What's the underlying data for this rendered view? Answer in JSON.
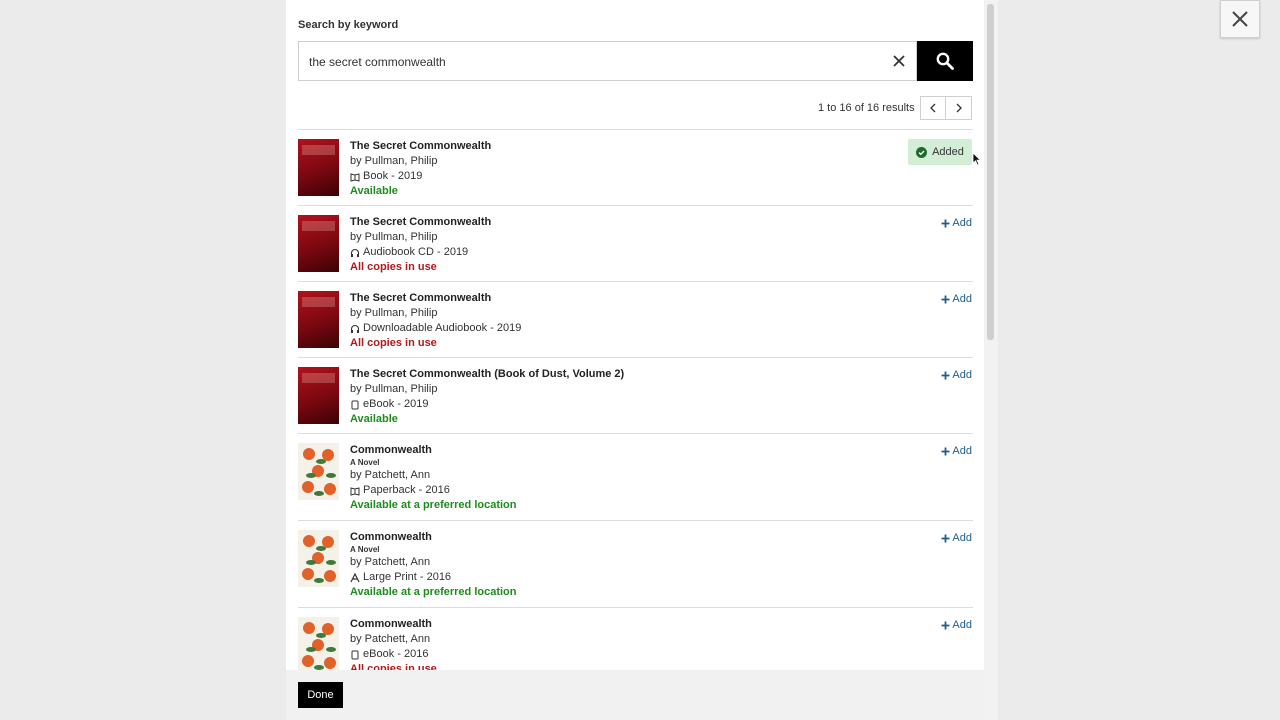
{
  "search": {
    "label": "Search by keyword",
    "value": "the secret commonwealth"
  },
  "pagination": {
    "summary": "1 to 16 of 16 results"
  },
  "results": [
    {
      "title": "The Secret Commonwealth",
      "subtitle": "",
      "author": "by Pullman, Philip",
      "format": "Book - 2019",
      "format_icon": "book-icon",
      "status": "Available",
      "status_type": "ok",
      "action": "Added",
      "cover": "red"
    },
    {
      "title": "The Secret Commonwealth",
      "subtitle": "",
      "author": "by Pullman, Philip",
      "format": "Audiobook CD - 2019",
      "format_icon": "headphones-icon",
      "status": "All copies in use",
      "status_type": "bad",
      "action": "Add",
      "cover": "red"
    },
    {
      "title": "The Secret Commonwealth",
      "subtitle": "",
      "author": "by Pullman, Philip",
      "format": "Downloadable Audiobook - 2019",
      "format_icon": "headphones-icon",
      "status": "All copies in use",
      "status_type": "bad",
      "action": "Add",
      "cover": "red"
    },
    {
      "title": "The Secret Commonwealth (Book of Dust, Volume 2)",
      "subtitle": "",
      "author": "by Pullman, Philip",
      "format": "eBook - 2019",
      "format_icon": "tablet-icon",
      "status": "Available",
      "status_type": "ok",
      "action": "Add",
      "cover": "red"
    },
    {
      "title": "Commonwealth",
      "subtitle": "A Novel",
      "author": "by Patchett, Ann",
      "format": "Paperback - 2016",
      "format_icon": "book-icon",
      "status": "Available at a preferred location",
      "status_type": "ok",
      "action": "Add",
      "cover": "white"
    },
    {
      "title": "Commonwealth",
      "subtitle": "A Novel",
      "author": "by Patchett, Ann",
      "format": "Large Print - 2016",
      "format_icon": "large-print-icon",
      "status": "Available at a preferred location",
      "status_type": "ok",
      "action": "Add",
      "cover": "white"
    },
    {
      "title": "Commonwealth",
      "subtitle": "",
      "author": "by Patchett, Ann",
      "format": "eBook - 2016",
      "format_icon": "tablet-icon",
      "status": "All copies in use",
      "status_type": "bad",
      "action": "Add",
      "cover": "white"
    }
  ],
  "footer": {
    "done_label": "Done"
  },
  "colors": {
    "available": "#1e8c1e",
    "in_use": "#b01a1a",
    "link": "#1f5d8c",
    "added_bg": "#d3eed6"
  }
}
